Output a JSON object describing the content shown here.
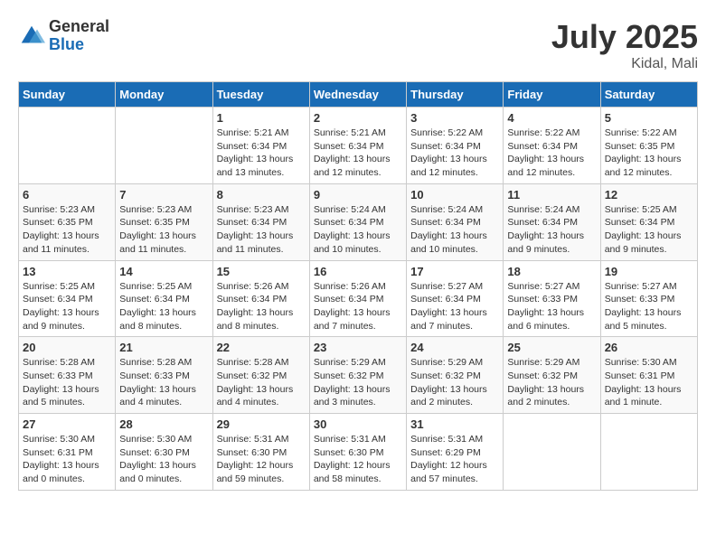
{
  "logo": {
    "general": "General",
    "blue": "Blue"
  },
  "title": "July 2025",
  "location": "Kidal, Mali",
  "days_of_week": [
    "Sunday",
    "Monday",
    "Tuesday",
    "Wednesday",
    "Thursday",
    "Friday",
    "Saturday"
  ],
  "weeks": [
    [
      {
        "day": "",
        "info": ""
      },
      {
        "day": "",
        "info": ""
      },
      {
        "day": "1",
        "info": "Sunrise: 5:21 AM\nSunset: 6:34 PM\nDaylight: 13 hours and 13 minutes."
      },
      {
        "day": "2",
        "info": "Sunrise: 5:21 AM\nSunset: 6:34 PM\nDaylight: 13 hours and 12 minutes."
      },
      {
        "day": "3",
        "info": "Sunrise: 5:22 AM\nSunset: 6:34 PM\nDaylight: 13 hours and 12 minutes."
      },
      {
        "day": "4",
        "info": "Sunrise: 5:22 AM\nSunset: 6:34 PM\nDaylight: 13 hours and 12 minutes."
      },
      {
        "day": "5",
        "info": "Sunrise: 5:22 AM\nSunset: 6:35 PM\nDaylight: 13 hours and 12 minutes."
      }
    ],
    [
      {
        "day": "6",
        "info": "Sunrise: 5:23 AM\nSunset: 6:35 PM\nDaylight: 13 hours and 11 minutes."
      },
      {
        "day": "7",
        "info": "Sunrise: 5:23 AM\nSunset: 6:35 PM\nDaylight: 13 hours and 11 minutes."
      },
      {
        "day": "8",
        "info": "Sunrise: 5:23 AM\nSunset: 6:34 PM\nDaylight: 13 hours and 11 minutes."
      },
      {
        "day": "9",
        "info": "Sunrise: 5:24 AM\nSunset: 6:34 PM\nDaylight: 13 hours and 10 minutes."
      },
      {
        "day": "10",
        "info": "Sunrise: 5:24 AM\nSunset: 6:34 PM\nDaylight: 13 hours and 10 minutes."
      },
      {
        "day": "11",
        "info": "Sunrise: 5:24 AM\nSunset: 6:34 PM\nDaylight: 13 hours and 9 minutes."
      },
      {
        "day": "12",
        "info": "Sunrise: 5:25 AM\nSunset: 6:34 PM\nDaylight: 13 hours and 9 minutes."
      }
    ],
    [
      {
        "day": "13",
        "info": "Sunrise: 5:25 AM\nSunset: 6:34 PM\nDaylight: 13 hours and 9 minutes."
      },
      {
        "day": "14",
        "info": "Sunrise: 5:25 AM\nSunset: 6:34 PM\nDaylight: 13 hours and 8 minutes."
      },
      {
        "day": "15",
        "info": "Sunrise: 5:26 AM\nSunset: 6:34 PM\nDaylight: 13 hours and 8 minutes."
      },
      {
        "day": "16",
        "info": "Sunrise: 5:26 AM\nSunset: 6:34 PM\nDaylight: 13 hours and 7 minutes."
      },
      {
        "day": "17",
        "info": "Sunrise: 5:27 AM\nSunset: 6:34 PM\nDaylight: 13 hours and 7 minutes."
      },
      {
        "day": "18",
        "info": "Sunrise: 5:27 AM\nSunset: 6:33 PM\nDaylight: 13 hours and 6 minutes."
      },
      {
        "day": "19",
        "info": "Sunrise: 5:27 AM\nSunset: 6:33 PM\nDaylight: 13 hours and 5 minutes."
      }
    ],
    [
      {
        "day": "20",
        "info": "Sunrise: 5:28 AM\nSunset: 6:33 PM\nDaylight: 13 hours and 5 minutes."
      },
      {
        "day": "21",
        "info": "Sunrise: 5:28 AM\nSunset: 6:33 PM\nDaylight: 13 hours and 4 minutes."
      },
      {
        "day": "22",
        "info": "Sunrise: 5:28 AM\nSunset: 6:32 PM\nDaylight: 13 hours and 4 minutes."
      },
      {
        "day": "23",
        "info": "Sunrise: 5:29 AM\nSunset: 6:32 PM\nDaylight: 13 hours and 3 minutes."
      },
      {
        "day": "24",
        "info": "Sunrise: 5:29 AM\nSunset: 6:32 PM\nDaylight: 13 hours and 2 minutes."
      },
      {
        "day": "25",
        "info": "Sunrise: 5:29 AM\nSunset: 6:32 PM\nDaylight: 13 hours and 2 minutes."
      },
      {
        "day": "26",
        "info": "Sunrise: 5:30 AM\nSunset: 6:31 PM\nDaylight: 13 hours and 1 minute."
      }
    ],
    [
      {
        "day": "27",
        "info": "Sunrise: 5:30 AM\nSunset: 6:31 PM\nDaylight: 13 hours and 0 minutes."
      },
      {
        "day": "28",
        "info": "Sunrise: 5:30 AM\nSunset: 6:30 PM\nDaylight: 13 hours and 0 minutes."
      },
      {
        "day": "29",
        "info": "Sunrise: 5:31 AM\nSunset: 6:30 PM\nDaylight: 12 hours and 59 minutes."
      },
      {
        "day": "30",
        "info": "Sunrise: 5:31 AM\nSunset: 6:30 PM\nDaylight: 12 hours and 58 minutes."
      },
      {
        "day": "31",
        "info": "Sunrise: 5:31 AM\nSunset: 6:29 PM\nDaylight: 12 hours and 57 minutes."
      },
      {
        "day": "",
        "info": ""
      },
      {
        "day": "",
        "info": ""
      }
    ]
  ]
}
